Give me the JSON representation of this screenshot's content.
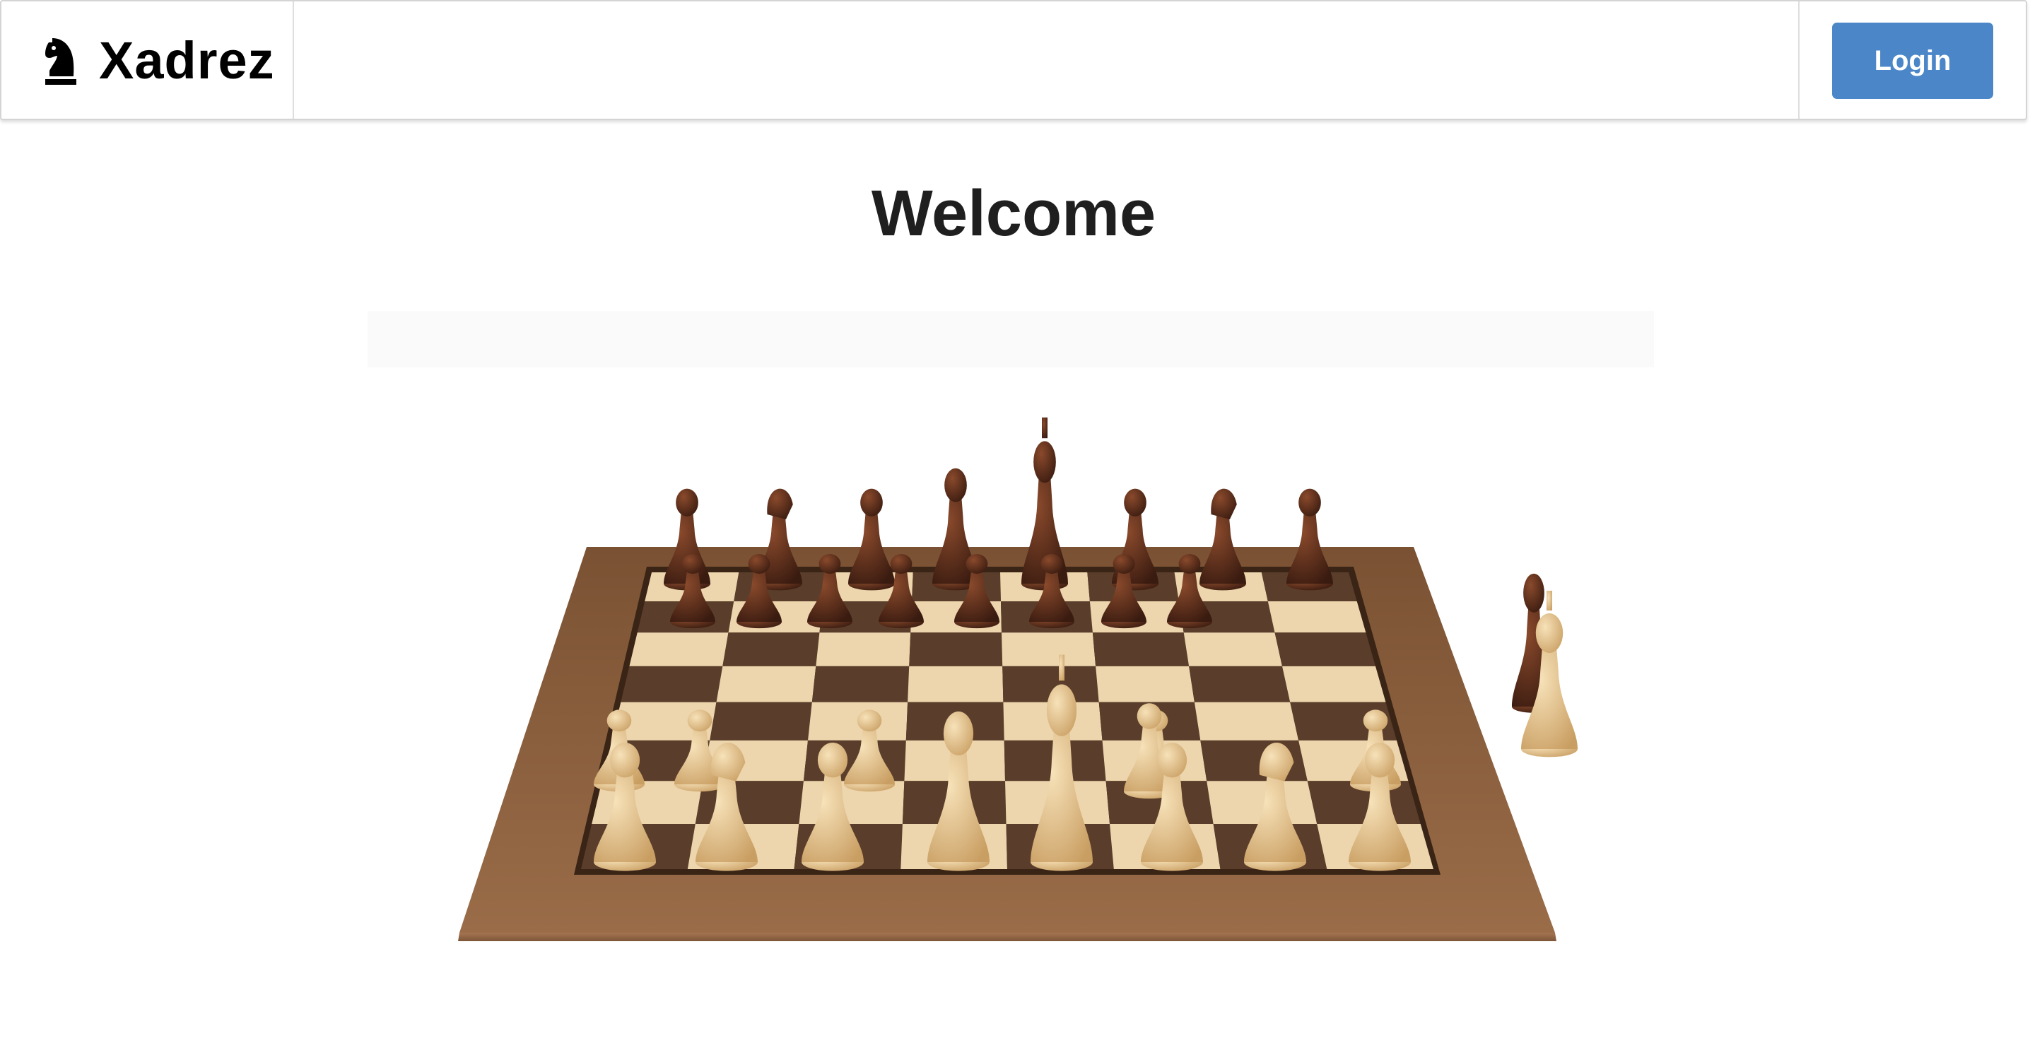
{
  "header": {
    "brand_name": "Xadrez",
    "brand_icon": "chess-knight-icon",
    "login_label": "Login"
  },
  "main": {
    "title": "Welcome",
    "hero_image": "chessboard-photo"
  },
  "colors": {
    "login_button": "#4a86c8",
    "title_text": "#1f1f1f",
    "board_frame": "#8a5f3f",
    "light_square": "#edd6ad",
    "dark_square": "#5a3e2b",
    "white_pieces": "#e2c48e",
    "black_pieces": "#5b2f1c"
  }
}
